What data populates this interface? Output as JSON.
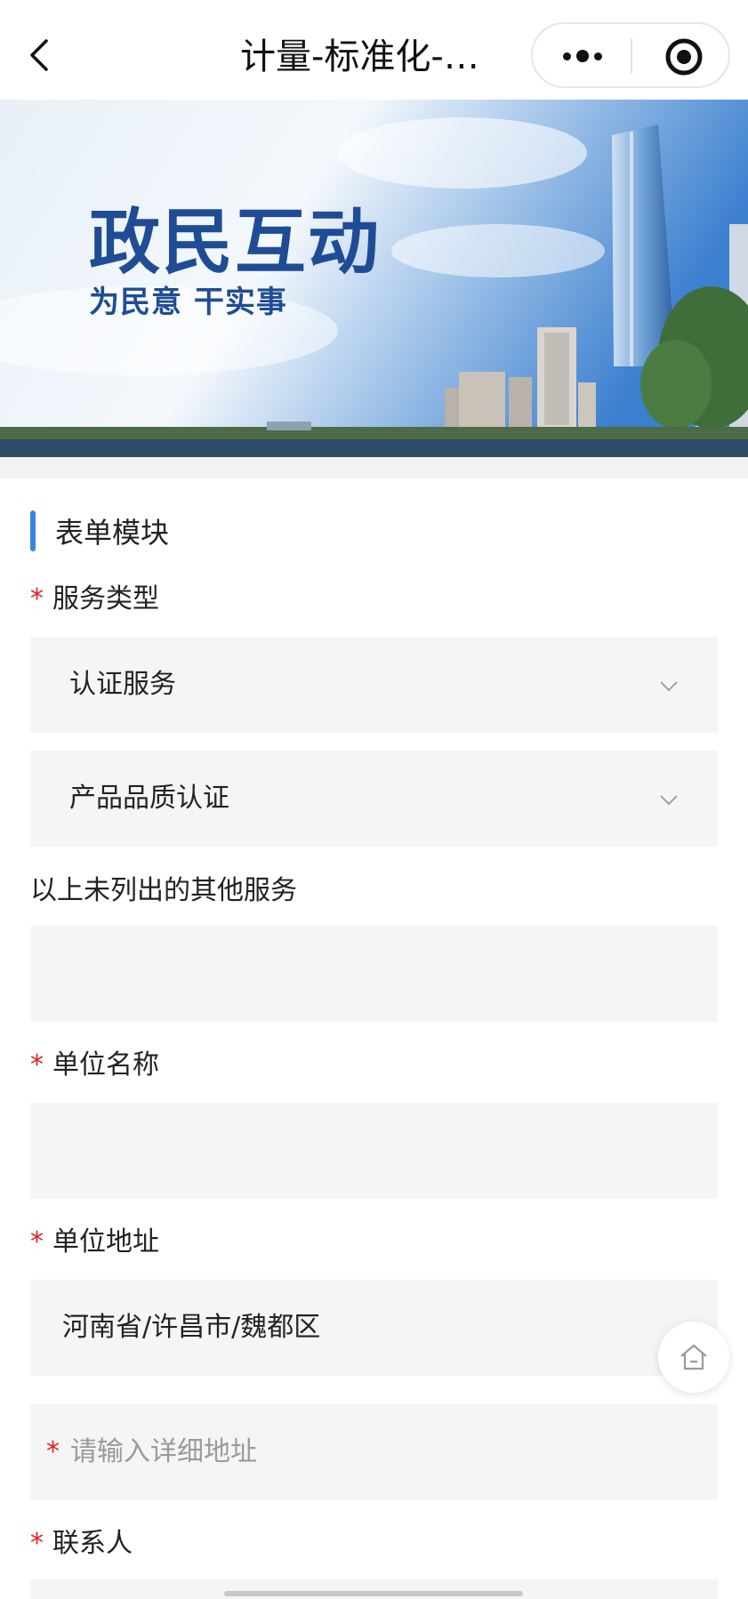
{
  "nav": {
    "title": "计量-标准化-…"
  },
  "banner": {
    "title": "政民互动",
    "subtitle": "为民意 干实事"
  },
  "form": {
    "section_title": "表单模块",
    "service_type": {
      "label": "服务类型",
      "required_mark": "*",
      "primary_value": "认证服务",
      "secondary_value": "产品品质认证"
    },
    "other_service": {
      "label": "以上未列出的其他服务",
      "value": ""
    },
    "unit_name": {
      "label": "单位名称",
      "required_mark": "*",
      "value": ""
    },
    "unit_address": {
      "label": "单位地址",
      "required_mark": "*",
      "region_value": "河南省/许昌市/魏都区",
      "detail_placeholder": "请输入详细地址",
      "detail_required_mark": "*"
    },
    "contact": {
      "label": "联系人",
      "required_mark": "*"
    }
  },
  "colors": {
    "accent_bar": "#3b82e6",
    "required": "#e02020",
    "field_bg": "#f5f5f5",
    "banner_text": "#1f4d95"
  },
  "icons": {
    "back": "back-arrow-icon",
    "more": "more-dots-icon",
    "close": "target-close-icon",
    "chevron": "chevron-down-icon",
    "home": "home-icon"
  }
}
